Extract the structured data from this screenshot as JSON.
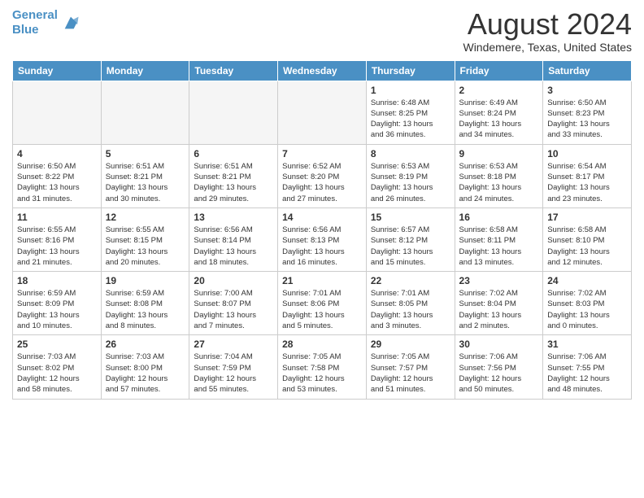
{
  "header": {
    "logo_line1": "General",
    "logo_line2": "Blue",
    "month": "August 2024",
    "location": "Windemere, Texas, United States"
  },
  "weekdays": [
    "Sunday",
    "Monday",
    "Tuesday",
    "Wednesday",
    "Thursday",
    "Friday",
    "Saturday"
  ],
  "weeks": [
    [
      {
        "day": "",
        "info": ""
      },
      {
        "day": "",
        "info": ""
      },
      {
        "day": "",
        "info": ""
      },
      {
        "day": "",
        "info": ""
      },
      {
        "day": "1",
        "info": "Sunrise: 6:48 AM\nSunset: 8:25 PM\nDaylight: 13 hours\nand 36 minutes."
      },
      {
        "day": "2",
        "info": "Sunrise: 6:49 AM\nSunset: 8:24 PM\nDaylight: 13 hours\nand 34 minutes."
      },
      {
        "day": "3",
        "info": "Sunrise: 6:50 AM\nSunset: 8:23 PM\nDaylight: 13 hours\nand 33 minutes."
      }
    ],
    [
      {
        "day": "4",
        "info": "Sunrise: 6:50 AM\nSunset: 8:22 PM\nDaylight: 13 hours\nand 31 minutes."
      },
      {
        "day": "5",
        "info": "Sunrise: 6:51 AM\nSunset: 8:21 PM\nDaylight: 13 hours\nand 30 minutes."
      },
      {
        "day": "6",
        "info": "Sunrise: 6:51 AM\nSunset: 8:21 PM\nDaylight: 13 hours\nand 29 minutes."
      },
      {
        "day": "7",
        "info": "Sunrise: 6:52 AM\nSunset: 8:20 PM\nDaylight: 13 hours\nand 27 minutes."
      },
      {
        "day": "8",
        "info": "Sunrise: 6:53 AM\nSunset: 8:19 PM\nDaylight: 13 hours\nand 26 minutes."
      },
      {
        "day": "9",
        "info": "Sunrise: 6:53 AM\nSunset: 8:18 PM\nDaylight: 13 hours\nand 24 minutes."
      },
      {
        "day": "10",
        "info": "Sunrise: 6:54 AM\nSunset: 8:17 PM\nDaylight: 13 hours\nand 23 minutes."
      }
    ],
    [
      {
        "day": "11",
        "info": "Sunrise: 6:55 AM\nSunset: 8:16 PM\nDaylight: 13 hours\nand 21 minutes."
      },
      {
        "day": "12",
        "info": "Sunrise: 6:55 AM\nSunset: 8:15 PM\nDaylight: 13 hours\nand 20 minutes."
      },
      {
        "day": "13",
        "info": "Sunrise: 6:56 AM\nSunset: 8:14 PM\nDaylight: 13 hours\nand 18 minutes."
      },
      {
        "day": "14",
        "info": "Sunrise: 6:56 AM\nSunset: 8:13 PM\nDaylight: 13 hours\nand 16 minutes."
      },
      {
        "day": "15",
        "info": "Sunrise: 6:57 AM\nSunset: 8:12 PM\nDaylight: 13 hours\nand 15 minutes."
      },
      {
        "day": "16",
        "info": "Sunrise: 6:58 AM\nSunset: 8:11 PM\nDaylight: 13 hours\nand 13 minutes."
      },
      {
        "day": "17",
        "info": "Sunrise: 6:58 AM\nSunset: 8:10 PM\nDaylight: 13 hours\nand 12 minutes."
      }
    ],
    [
      {
        "day": "18",
        "info": "Sunrise: 6:59 AM\nSunset: 8:09 PM\nDaylight: 13 hours\nand 10 minutes."
      },
      {
        "day": "19",
        "info": "Sunrise: 6:59 AM\nSunset: 8:08 PM\nDaylight: 13 hours\nand 8 minutes."
      },
      {
        "day": "20",
        "info": "Sunrise: 7:00 AM\nSunset: 8:07 PM\nDaylight: 13 hours\nand 7 minutes."
      },
      {
        "day": "21",
        "info": "Sunrise: 7:01 AM\nSunset: 8:06 PM\nDaylight: 13 hours\nand 5 minutes."
      },
      {
        "day": "22",
        "info": "Sunrise: 7:01 AM\nSunset: 8:05 PM\nDaylight: 13 hours\nand 3 minutes."
      },
      {
        "day": "23",
        "info": "Sunrise: 7:02 AM\nSunset: 8:04 PM\nDaylight: 13 hours\nand 2 minutes."
      },
      {
        "day": "24",
        "info": "Sunrise: 7:02 AM\nSunset: 8:03 PM\nDaylight: 13 hours\nand 0 minutes."
      }
    ],
    [
      {
        "day": "25",
        "info": "Sunrise: 7:03 AM\nSunset: 8:02 PM\nDaylight: 12 hours\nand 58 minutes."
      },
      {
        "day": "26",
        "info": "Sunrise: 7:03 AM\nSunset: 8:00 PM\nDaylight: 12 hours\nand 57 minutes."
      },
      {
        "day": "27",
        "info": "Sunrise: 7:04 AM\nSunset: 7:59 PM\nDaylight: 12 hours\nand 55 minutes."
      },
      {
        "day": "28",
        "info": "Sunrise: 7:05 AM\nSunset: 7:58 PM\nDaylight: 12 hours\nand 53 minutes."
      },
      {
        "day": "29",
        "info": "Sunrise: 7:05 AM\nSunset: 7:57 PM\nDaylight: 12 hours\nand 51 minutes."
      },
      {
        "day": "30",
        "info": "Sunrise: 7:06 AM\nSunset: 7:56 PM\nDaylight: 12 hours\nand 50 minutes."
      },
      {
        "day": "31",
        "info": "Sunrise: 7:06 AM\nSunset: 7:55 PM\nDaylight: 12 hours\nand 48 minutes."
      }
    ]
  ]
}
